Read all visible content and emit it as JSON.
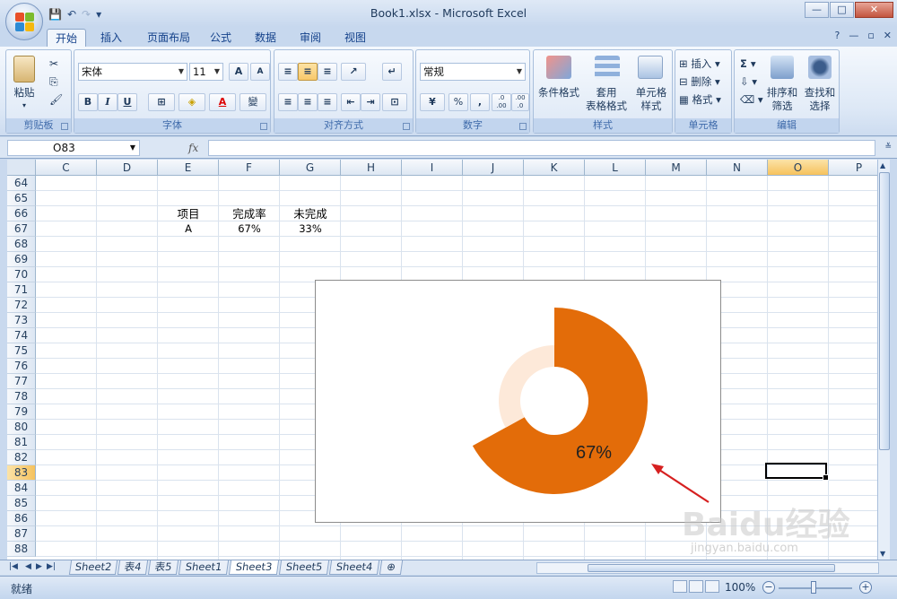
{
  "window": {
    "title": "Book1.xlsx - Microsoft Excel",
    "controls": [
      "—",
      "□",
      "✕"
    ]
  },
  "qat": {
    "save": "💾",
    "undo": "↶",
    "redo": "↷",
    "more": "▾"
  },
  "ribbon_tabs": [
    "开始",
    "插入",
    "页面布局",
    "公式",
    "数据",
    "审阅",
    "视图"
  ],
  "active_tab": "开始",
  "ribbon": {
    "clipboard": {
      "label": "剪贴板",
      "paste": "粘贴"
    },
    "font": {
      "label": "字体",
      "name": "宋体",
      "size": "11",
      "bold": "B",
      "italic": "I",
      "underline": "U",
      "grow": "A",
      "shrink": "A",
      "color": "A",
      "phonetic": "變"
    },
    "alignment": {
      "label": "对齐方式"
    },
    "number": {
      "label": "数字",
      "format": "常规",
      "percent": "%",
      "comma": ",",
      "inc_dec": ".0 .00",
      "dec_dec": ".00 .0"
    },
    "styles": {
      "label": "样式",
      "cond_format": "条件格式",
      "table_format": "套用\n表格格式",
      "cell_style": "单元格\n样式"
    },
    "cells": {
      "label": "单元格",
      "insert": "插入",
      "delete": "删除",
      "format": "格式"
    },
    "editing": {
      "label": "编辑",
      "sort": "排序和\n筛选",
      "find": "查找和\n选择",
      "sigma": "Σ"
    }
  },
  "formula_bar": {
    "namebox": "O83",
    "fx": "fx",
    "value": ""
  },
  "columns": [
    "C",
    "D",
    "E",
    "F",
    "G",
    "H",
    "I",
    "J",
    "K",
    "L",
    "M",
    "N",
    "O",
    "P"
  ],
  "selected_column": "O",
  "rows": [
    "64",
    "65",
    "66",
    "67",
    "68",
    "69",
    "70",
    "71",
    "72",
    "73",
    "74",
    "75",
    "76",
    "77",
    "78",
    "79",
    "80",
    "81",
    "82",
    "83",
    "84",
    "85",
    "86",
    "87",
    "88"
  ],
  "selected_row": "83",
  "cells": {
    "e66": "项目",
    "f66": "完成率",
    "g66": "未完成",
    "e67": "A",
    "f67": "67%",
    "g67": "33%"
  },
  "chart_data": {
    "type": "pie",
    "subtype": "doughnut",
    "slices": [
      {
        "label": "完成率",
        "value": 67,
        "color": "#e36c09",
        "radius": "outer"
      },
      {
        "label": "未完成",
        "value": 33,
        "color": "#fde9d9",
        "radius": "inner"
      }
    ],
    "data_label": "67%",
    "legend": "none",
    "title": ""
  },
  "sheet_tabs": [
    "Sheet2",
    "表4",
    "表5",
    "Sheet1",
    "Sheet3",
    "Sheet5",
    "Sheet4"
  ],
  "active_sheet": "Sheet3",
  "status": {
    "mode": "就绪",
    "zoom": "100%"
  },
  "watermark": {
    "brand": "Baidu经验",
    "url": "jingyan.baidu.com"
  }
}
